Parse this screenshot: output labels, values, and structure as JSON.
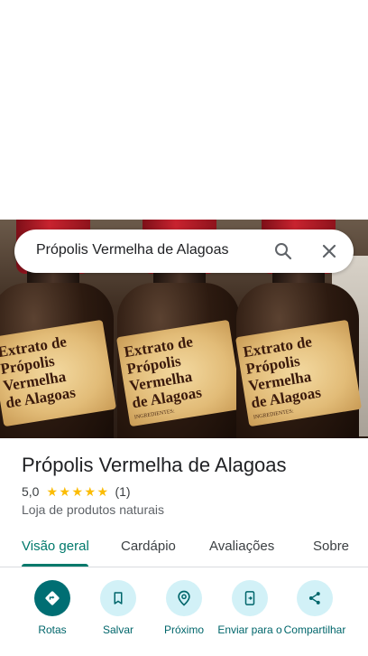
{
  "search": {
    "query": "Própolis Vermelha de Alagoas",
    "search_icon": "search-icon",
    "close_icon": "close-icon"
  },
  "photo": {
    "label_line1": "Extrato de",
    "label_line2": "Própolis Vermelha",
    "label_line3": "de Alagoas",
    "label_ingredients": "INGREDIENTES:"
  },
  "place": {
    "name": "Própolis Vermelha de Alagoas",
    "rating": "5,0",
    "stars": 5,
    "review_count": "(1)",
    "category": "Loja de produtos naturais"
  },
  "tabs": [
    {
      "label": "Visão geral",
      "active": true
    },
    {
      "label": "Cardápio",
      "active": false
    },
    {
      "label": "Avaliações",
      "active": false
    },
    {
      "label": "Sobre",
      "active": false
    }
  ],
  "actions": [
    {
      "label": "Rotas",
      "icon": "directions-icon"
    },
    {
      "label": "Salvar",
      "icon": "bookmark-icon"
    },
    {
      "label": "Próximo",
      "icon": "nearby-icon"
    },
    {
      "label": "Enviar para o",
      "icon": "send-to-phone-icon"
    },
    {
      "label": "Compartilhar",
      "icon": "share-icon"
    }
  ],
  "colors": {
    "accent": "#00796b",
    "action_bg": "#d2f1f7",
    "primary_action_bg": "#006e73",
    "star": "#fbbc04"
  }
}
